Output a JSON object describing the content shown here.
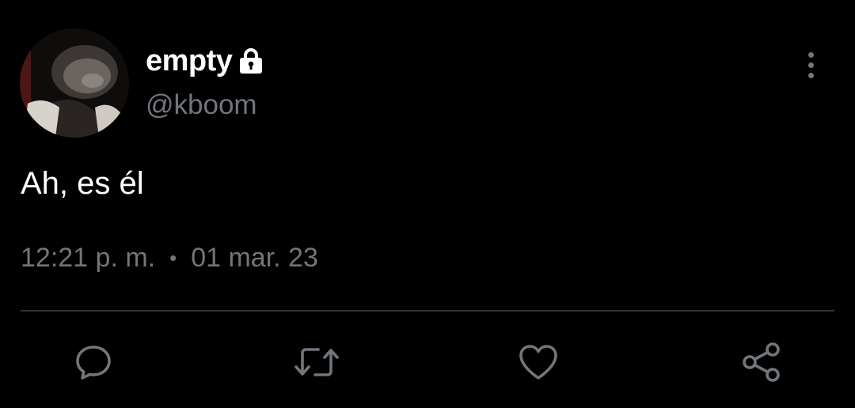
{
  "tweet": {
    "display_name": "empty",
    "handle": "@kboom",
    "protected_icon": "lock-icon",
    "text": "Ah, es él",
    "time": "12:21 p. m.",
    "separator": "•",
    "date": "01 mar. 23"
  },
  "actions": [
    {
      "name": "reply",
      "icon": "reply-icon"
    },
    {
      "name": "retweet",
      "icon": "retweet-icon"
    },
    {
      "name": "like",
      "icon": "heart-icon"
    },
    {
      "name": "share",
      "icon": "share-icon"
    }
  ],
  "colors": {
    "background": "#000000",
    "primary_text": "#ffffff",
    "secondary_text": "#71767b",
    "divider": "#2f3336"
  }
}
